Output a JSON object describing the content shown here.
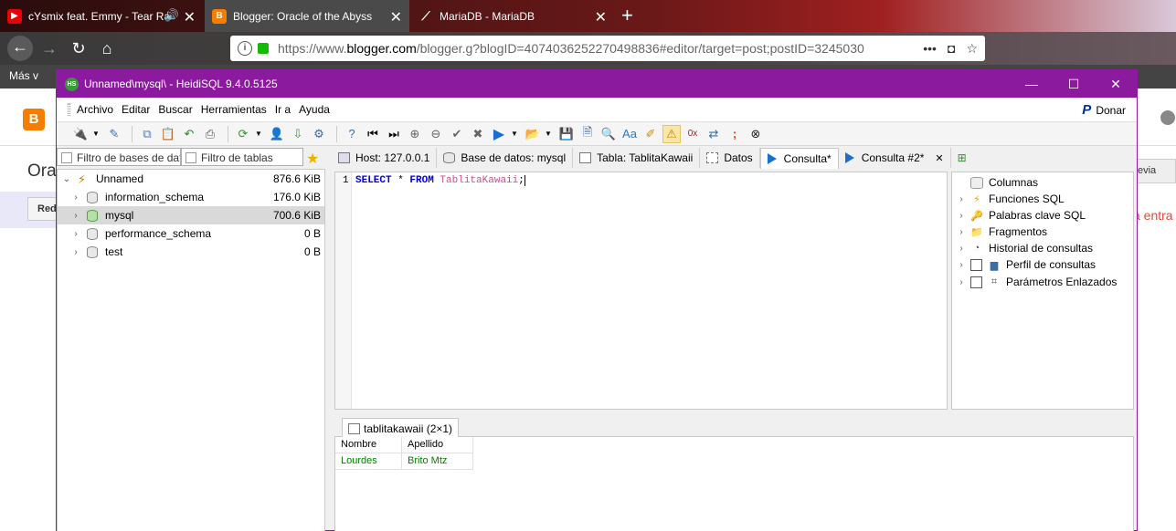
{
  "browser": {
    "tabs": [
      {
        "label": "cYsmix feat. Emmy - Tear Ra",
        "icon": "youtube-icon"
      },
      {
        "label": "Blogger: Oracle of the Abyss",
        "icon": "blogger-icon"
      },
      {
        "label": "MariaDB - MariaDB",
        "icon": "mariadb-icon"
      }
    ],
    "url_prefix": "https://www.",
    "url_host": "blogger.com",
    "url_rest": "/blogger.g?blogID=4074036252270498836#editor/target=post;postID=3245030",
    "bookmarks_label": "Más v"
  },
  "blogger": {
    "title_fragment": "Ora",
    "button_fragment": "Red",
    "right_button_fragment": "evia",
    "right_text_fragment": "a entra"
  },
  "window": {
    "title": "Unnamed\\mysql\\ - HeidiSQL 9.4.0.5125",
    "menu": [
      "Archivo",
      "Editar",
      "Buscar",
      "Herramientas",
      "Ir a",
      "Ayuda"
    ],
    "donate_label": "Donar"
  },
  "left": {
    "db_filter_placeholder": "Filtro de bases de dat",
    "table_filter_placeholder": "Filtro de tablas",
    "tree": [
      {
        "label": "Unnamed",
        "size": "876.6 KiB"
      },
      {
        "label": "information_schema",
        "size": "176.0 KiB"
      },
      {
        "label": "mysql",
        "size": "700.6 KiB"
      },
      {
        "label": "performance_schema",
        "size": "0 B"
      },
      {
        "label": "test",
        "size": "0 B"
      }
    ]
  },
  "tabs": {
    "host": "Host: 127.0.0.1",
    "database": "Base de datos: mysql",
    "table": "Tabla: TablitaKawaii",
    "data": "Datos",
    "query": "Consulta*",
    "query2": "Consulta #2*"
  },
  "editor": {
    "line_number": "1",
    "kw_select": "SELECT",
    "star": " * ",
    "kw_from": "FROM",
    "table": " TablitaKawaii",
    "end": ";"
  },
  "helper": {
    "items": [
      "Columnas",
      "Funciones SQL",
      "Palabras clave SQL",
      "Fragmentos",
      "Historial de consultas",
      "Perfil de consultas",
      "Parámetros Enlazados"
    ]
  },
  "results": {
    "tab_label": "tablitakawaii (2×1)",
    "columns": [
      "Nombre",
      "Apellido"
    ],
    "rows": [
      [
        "Lourdes",
        "Brito Mtz"
      ]
    ]
  },
  "colors": {
    "titlebar": "#8c1a9e",
    "keyword": "#0000d0",
    "table_name": "#c05090",
    "cell_value": "#008000"
  }
}
